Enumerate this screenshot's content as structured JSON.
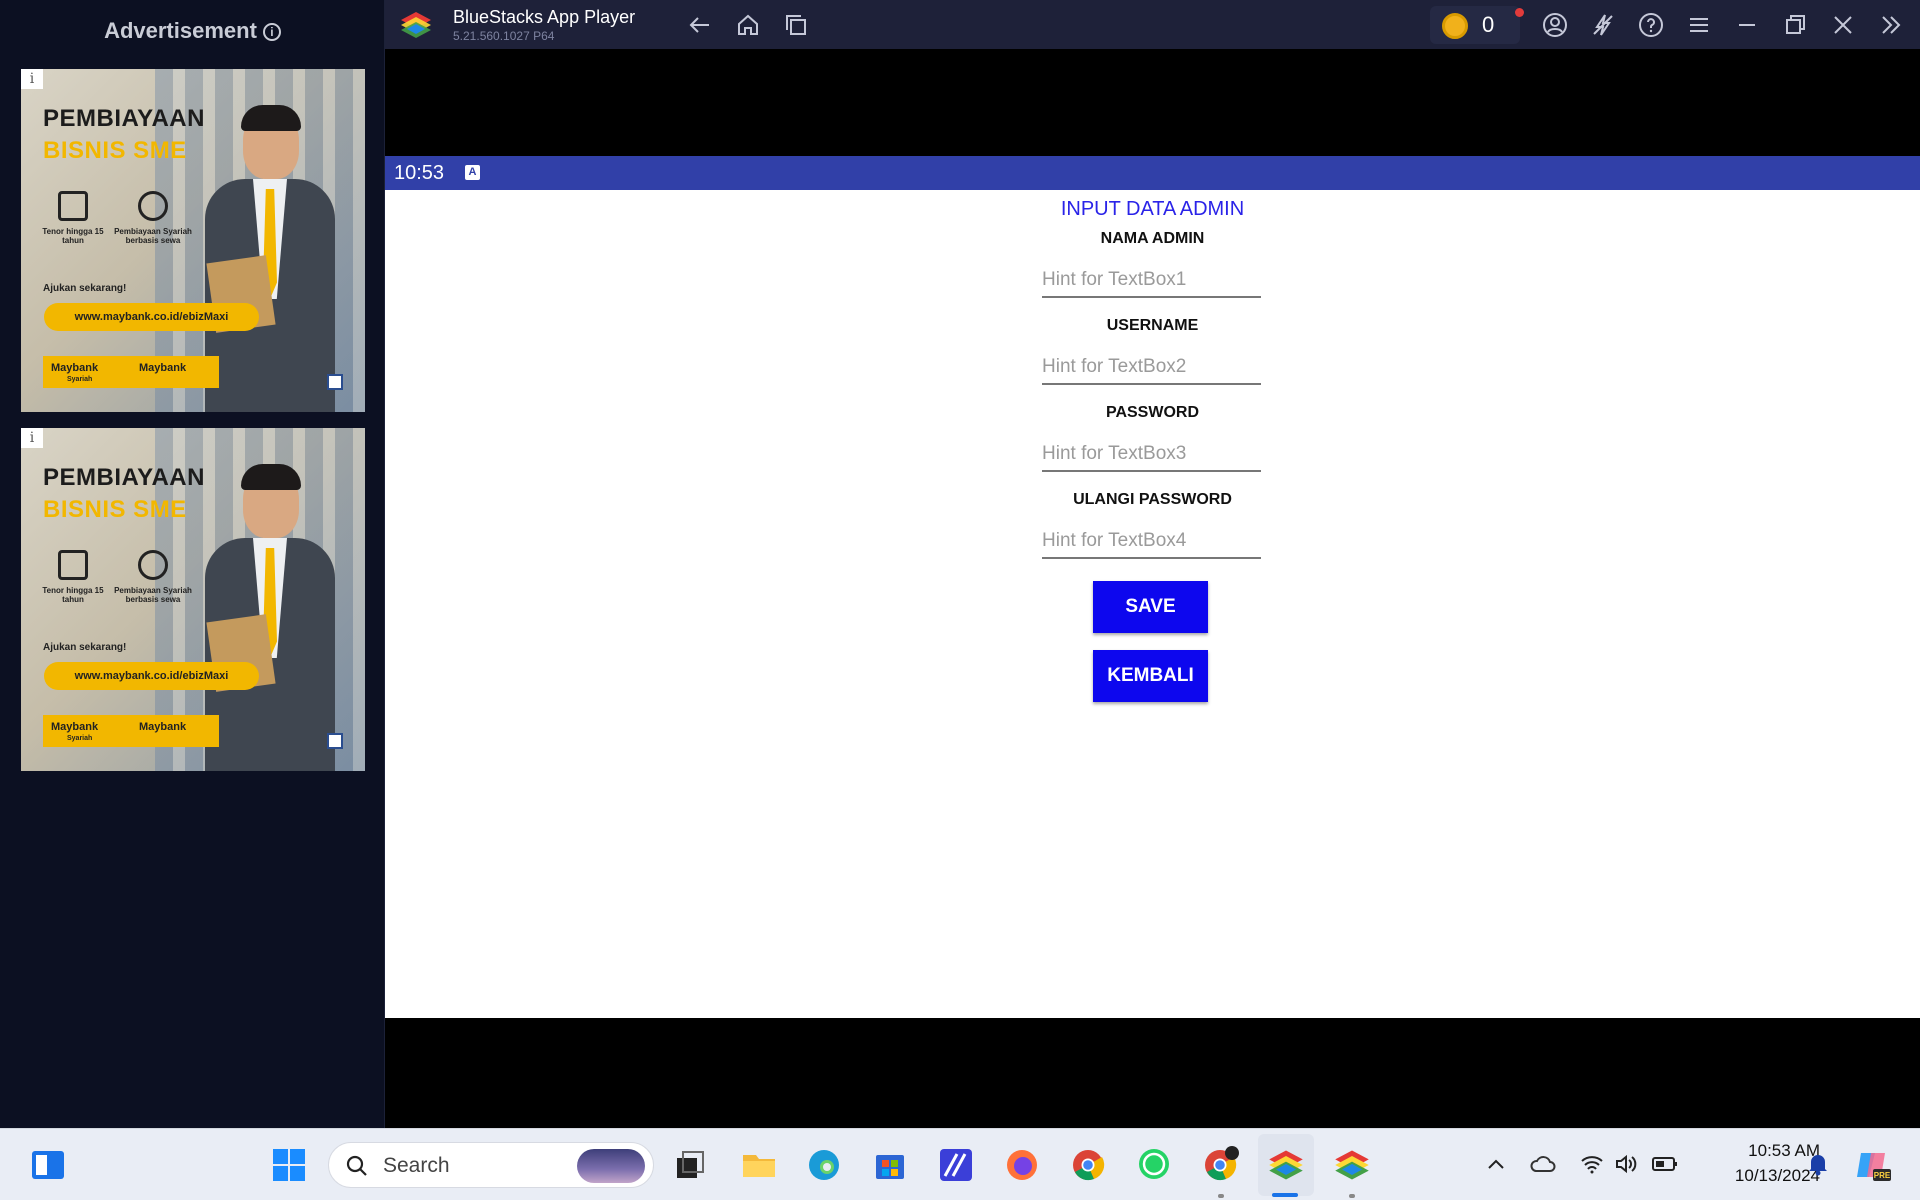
{
  "ad": {
    "header": "Advertisement",
    "info_symbol": "i",
    "banners": [
      {
        "headline1": "PEMBIAYAAN",
        "headline2": "BISNIS SME",
        "feature1": "Tenor hingga 15 tahun",
        "feature2": "Pembiayaan Syariah berbasis sewa",
        "cta": "Ajukan sekarang!",
        "url": "www.maybank.co.id/ebizMaxi",
        "logo1": "Maybank",
        "logo1_sub": "Syariah",
        "logo2": "Maybank"
      },
      {
        "headline1": "PEMBIAYAAN",
        "headline2": "BISNIS SME",
        "feature1": "Tenor hingga 15 tahun",
        "feature2": "Pembiayaan Syariah berbasis sewa",
        "cta": "Ajukan sekarang!",
        "url": "www.maybank.co.id/ebizMaxi",
        "logo1": "Maybank",
        "logo1_sub": "Syariah",
        "logo2": "Maybank"
      }
    ]
  },
  "window": {
    "title": "BlueStacks App Player",
    "version": "5.21.560.1027  P64",
    "coins": "0"
  },
  "statusbar": {
    "time": "10:53",
    "badge": "A"
  },
  "app": {
    "title": "INPUT DATA ADMIN",
    "fields": [
      {
        "label": "NAMA ADMIN",
        "placeholder": "Hint for TextBox1"
      },
      {
        "label": "USERNAME",
        "placeholder": "Hint for TextBox2"
      },
      {
        "label": "PASSWORD",
        "placeholder": "Hint for TextBox3"
      },
      {
        "label": "ULANGI PASSWORD",
        "placeholder": "Hint for TextBox4"
      }
    ],
    "save_label": "SAVE",
    "back_label": "KEMBALI"
  },
  "taskbar": {
    "search_label": "Search",
    "time": "10:53 AM",
    "date": "10/13/2024"
  },
  "colors": {
    "statusbar": "#3140a8",
    "button": "#0d07ee",
    "app_title": "#2a23e8",
    "titlebar": "#1e2139"
  }
}
